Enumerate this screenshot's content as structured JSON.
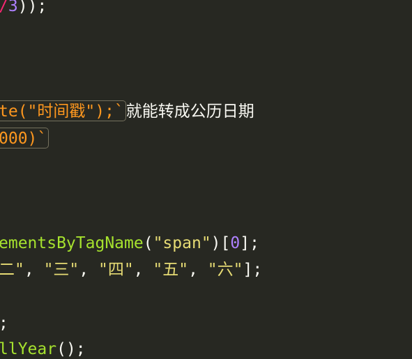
{
  "editor": {
    "theme_colors": {
      "background": "#272822",
      "punctuation": "#f8f8f2",
      "operator": "#f92672",
      "number": "#ae81ff",
      "string": "#e6db74",
      "function": "#a6e22e",
      "template": "#fd971f"
    },
    "lines": {
      "l1": {
        "op": "/",
        "num": "3",
        "rest": "));"
      },
      "l2": {
        "tmpl": "te(\"时间戳\");`",
        "comment": "就能转成公历日期"
      },
      "l3": {
        "tmpl": "000)`"
      },
      "l4": {
        "func": "ementsByTagName",
        "open": "(",
        "str": "\"span\"",
        "close": ")[",
        "num": "0",
        "end": "];"
      },
      "l5": {
        "s1": "二\"",
        "c1": ", ",
        "s2": "\"三\"",
        "c2": ", ",
        "s3": "\"四\"",
        "c3": ", ",
        "s4": "\"五\"",
        "c4": ", ",
        "s5": "\"六\"",
        "end": "];"
      },
      "l6": {
        "text": ";"
      },
      "l7": {
        "func": "llYear",
        "rest": "();"
      }
    }
  }
}
